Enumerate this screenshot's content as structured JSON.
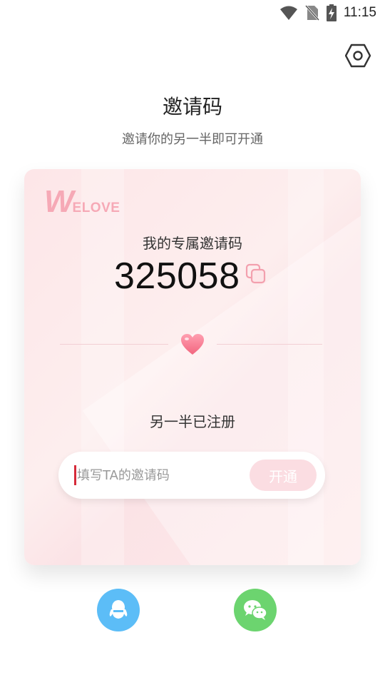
{
  "status_bar": {
    "time": "11:15",
    "icons": [
      "wifi-icon",
      "no-sim-icon",
      "battery-charging-icon"
    ]
  },
  "header": {
    "settings_icon": "settings-icon",
    "title": "邀请码",
    "subtitle": "邀请你的另一半即可开通"
  },
  "card": {
    "logo_first_letter": "W",
    "logo_rest": "ELOVE",
    "my_code_label": "我的专属邀请码",
    "my_code": "325058",
    "copy_icon": "copy-icon",
    "divider_icon": "heart-icon",
    "registered_label": "另一半已注册",
    "input": {
      "value": "",
      "placeholder": "填写TA的邀请码"
    },
    "open_button_label": "开通"
  },
  "share": {
    "buttons": [
      {
        "name": "qq",
        "icon": "qq-icon",
        "color": "#5cbdf7"
      },
      {
        "name": "wechat",
        "icon": "wechat-icon",
        "color": "#6cd46f"
      }
    ]
  },
  "colors": {
    "accent_pink": "#f6a9b6",
    "button_pink": "#fbdde2",
    "card_bg": "#fde6e8"
  }
}
